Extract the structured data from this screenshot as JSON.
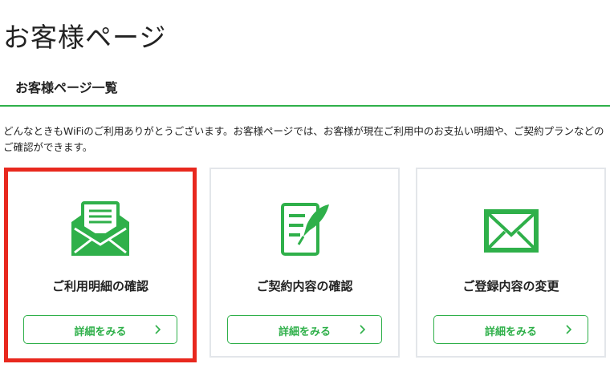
{
  "page": {
    "title": "お客様ページ"
  },
  "section": {
    "heading": "お客様ページ一覧",
    "intro": "どんなときもWiFiのご利用ありがとうございます。お客様ページでは、お客様が現在ご利用中のお支払い明細や、ご契約プランなどのご確認ができます。"
  },
  "cards": [
    {
      "title": "ご利用明細の確認",
      "icon": "open-envelope-letter-icon",
      "button_label": "詳細をみる",
      "selected": true
    },
    {
      "title": "ご契約内容の確認",
      "icon": "document-pen-icon",
      "button_label": "詳細をみる",
      "selected": false
    },
    {
      "title": "ご登録内容の変更",
      "icon": "envelope-icon",
      "button_label": "詳細をみる",
      "selected": false
    }
  ],
  "colors": {
    "accent_green": "#2fb04a",
    "highlight_red": "#e8281e",
    "card_border": "#e3e6ea"
  }
}
